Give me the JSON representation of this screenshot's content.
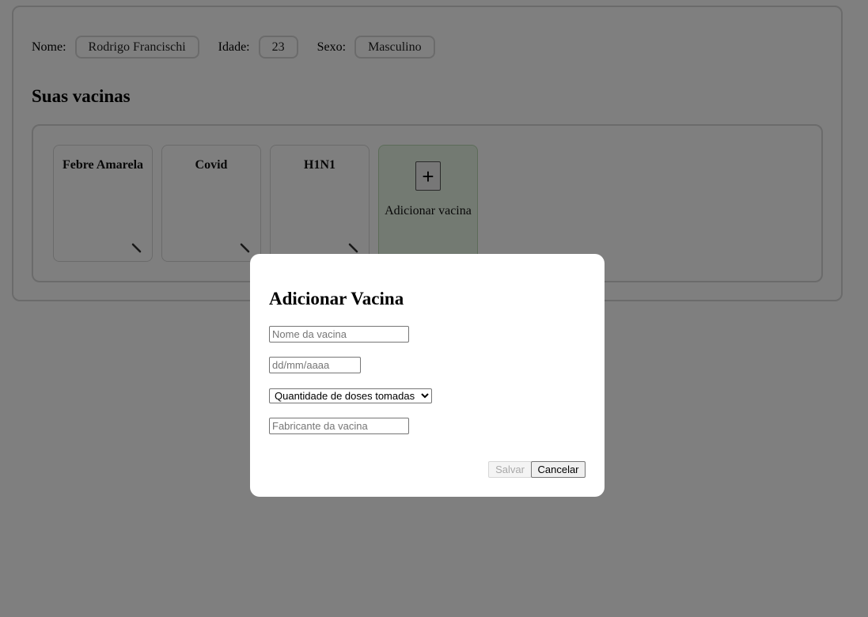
{
  "profile": {
    "name_label": "Nome:",
    "name_value": "Rodrigo Francischi",
    "age_label": "Idade:",
    "age_value": "23",
    "sex_label": "Sexo:",
    "sex_value": "Masculino"
  },
  "vaccines_section": {
    "title": "Suas vacinas",
    "cards": [
      {
        "name": "Febre Amarela",
        "icon": "pencil-icon"
      },
      {
        "name": "Covid",
        "icon": "pencil-icon"
      },
      {
        "name": "H1N1",
        "icon": "pencil-icon"
      }
    ],
    "add_card": {
      "button_symbol": "+",
      "label": "Adicionar vacina"
    }
  },
  "modal": {
    "title": "Adicionar Vacina",
    "name_placeholder": "Nome da vacina",
    "date_placeholder": "dd/mm/aaaa",
    "doses_selected": "Quantidade de doses tomadas",
    "manufacturer_placeholder": "Fabricante da vacina",
    "save_label": "Salvar",
    "cancel_label": "Cancelar"
  },
  "colors": {
    "overlay": "#000000",
    "add_card_bg": "#e6f4e4",
    "border": "#d6d6d6"
  }
}
